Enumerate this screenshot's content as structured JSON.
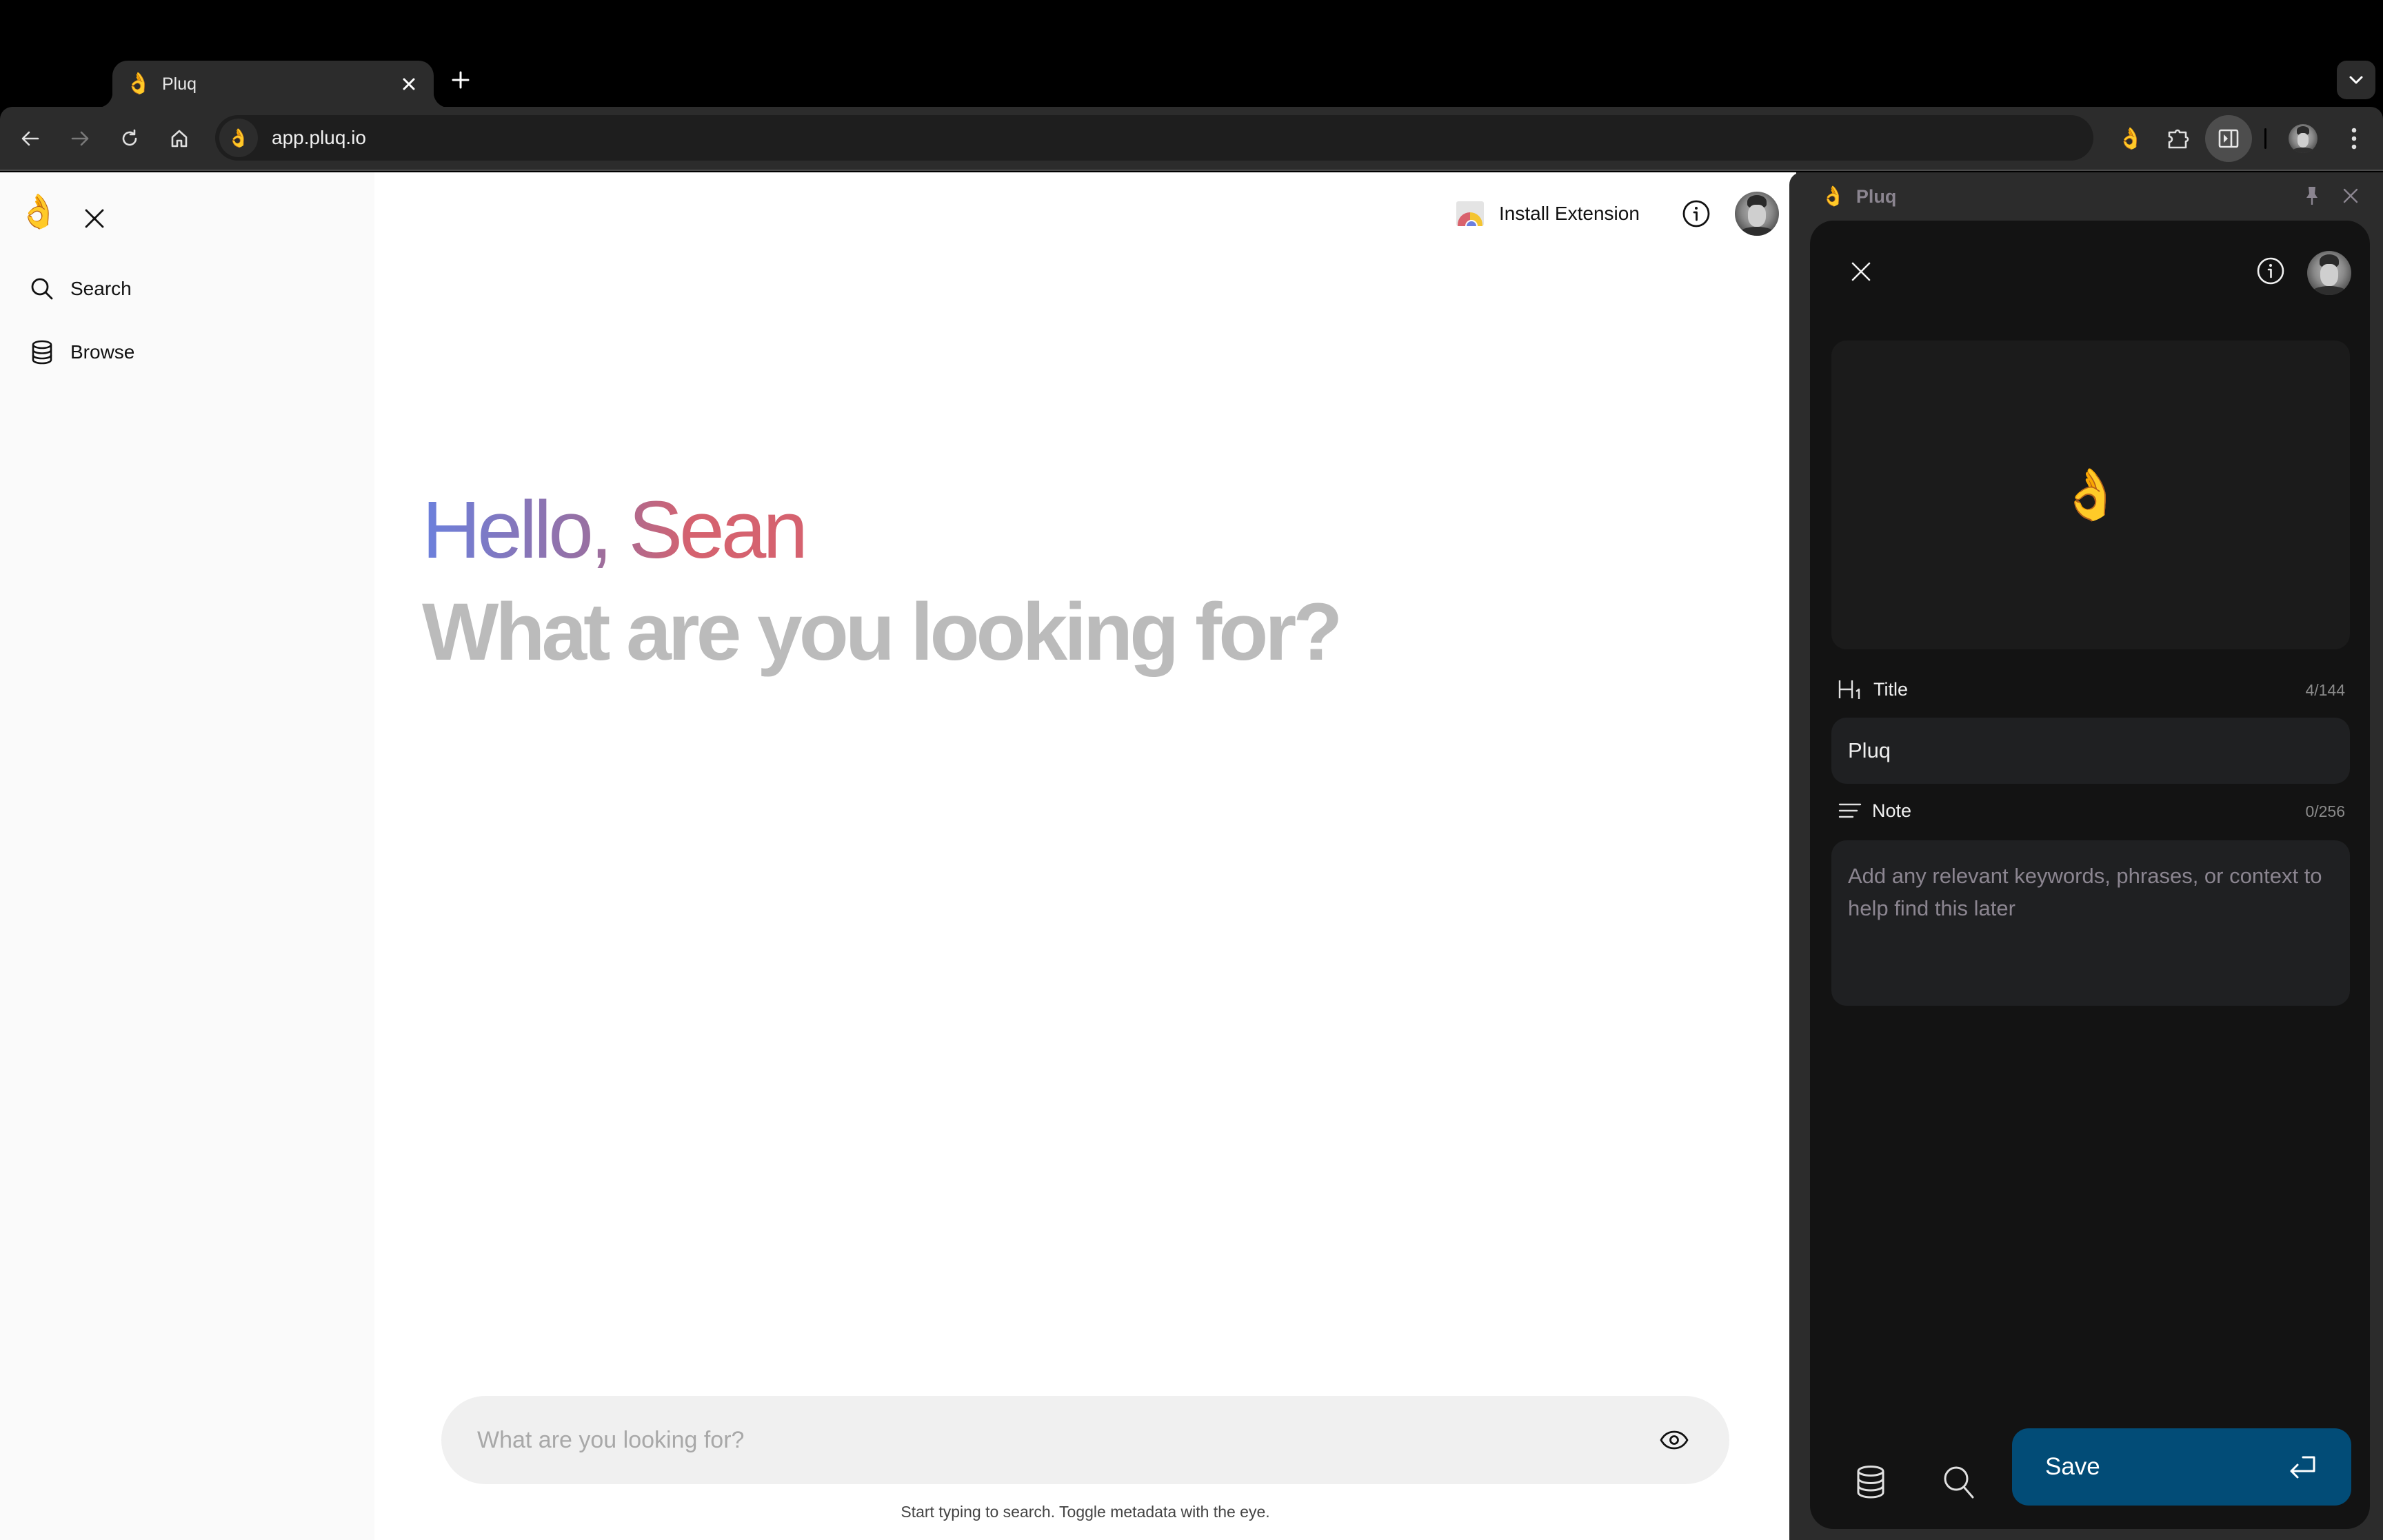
{
  "browser": {
    "tab": {
      "favicon": "👌",
      "title": "Pluq"
    },
    "url": "app.pluq.io",
    "omnibox_icon": "👌",
    "extension_icon": "👌"
  },
  "sidebar": {
    "logo": "👌",
    "items": [
      {
        "label": "Search",
        "icon": "search-icon"
      },
      {
        "label": "Browse",
        "icon": "database-icon"
      }
    ]
  },
  "header": {
    "install_label": "Install Extension"
  },
  "main": {
    "greeting": "Hello, Sean",
    "subtitle": "What are you looking for?",
    "search_placeholder": "What are you looking for?",
    "search_value": "",
    "hint": "Start typing to search. Toggle metadata with the eye."
  },
  "side_panel": {
    "header_title": "Pluq",
    "header_icon": "👌",
    "preview_emoji": "👌",
    "title_field": {
      "label": "Title",
      "value": "Pluq",
      "count": "4/144"
    },
    "note_field": {
      "label": "Note",
      "value": "",
      "placeholder": "Add any relevant keywords, phrases, or context to help find this later",
      "count": "0/256"
    },
    "save_label": "Save",
    "colors": {
      "save_button": "#024c77",
      "panel_bg": "#131313"
    }
  },
  "colors": {
    "greeting_start": "#6b80dd",
    "greeting_end": "#d5626f",
    "subtitle": "#bbbbbb"
  }
}
